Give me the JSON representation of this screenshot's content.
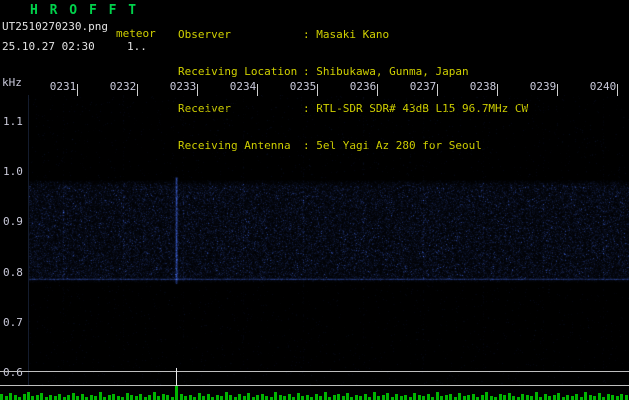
{
  "header": {
    "app_title": "H R O F F T",
    "filename": "UT2510270230.png",
    "station_label": "meteor",
    "datetime": "25.10.27 02:30",
    "counter": "1..",
    "colon": ": ",
    "info": [
      {
        "label": "Observer",
        "value": "Masaki Kano"
      },
      {
        "label": "Receiving Location",
        "value": "Shibukawa, Gunma, Japan"
      },
      {
        "label": "Receiver",
        "value": "RTL-SDR SDR# 43dB L15 96.7MHz CW"
      },
      {
        "label": "Receiving Antenna",
        "value": "5el Yagi Az 280 for Seoul"
      }
    ]
  },
  "colors": {
    "title_green": "#00d24b",
    "header_yellow": "#d0d000",
    "text_white": "#e2e2e2",
    "axis_label": "#c9c9da",
    "divider_line": "#bfbfbf",
    "bar_green": "#00b400"
  },
  "chart_data": {
    "type": "heatmap",
    "title": "HROFFT radio meteor spectrogram, 10-minute window 02:30-02:40 UT, 96.7MHz",
    "x_ticks": [
      "0231",
      "0232",
      "0233",
      "0234",
      "0235",
      "0236",
      "0237",
      "0238",
      "0239",
      "0240"
    ],
    "y_unit_label": "kHz",
    "y_ticks": [
      {
        "label": "1.1",
        "f": 1.1
      },
      {
        "label": "1.0",
        "f": 1.0
      },
      {
        "label": "0.9",
        "f": 0.9
      },
      {
        "label": "0.8",
        "f": 0.8
      },
      {
        "label": "0.7",
        "f": 0.7
      },
      {
        "label": "0.6",
        "f": 0.6
      }
    ],
    "ylim": [
      0.576,
      1.154
    ],
    "grid": false,
    "noise_band": {
      "f_top": 0.985,
      "f_bottom": 0.782
    },
    "carrier_line_freq": 0.787,
    "event": {
      "x_frac": 0.28,
      "f_top": 0.99,
      "f_bottom": 0.78
    },
    "seed": 20251027,
    "signal_bars": [
      6,
      4,
      7,
      5,
      3,
      6,
      8,
      4,
      5,
      7,
      3,
      5,
      4,
      6,
      3,
      5,
      7,
      4,
      6,
      3,
      5,
      4,
      8,
      3,
      5,
      6,
      4,
      3,
      7,
      5,
      4,
      6,
      3,
      5,
      8,
      4,
      6,
      5,
      3,
      14,
      6,
      4,
      5,
      3,
      7,
      4,
      6,
      3,
      5,
      4,
      8,
      5,
      3,
      6,
      4,
      7,
      3,
      5,
      6,
      4,
      3,
      8,
      5,
      4,
      6,
      3,
      7,
      4,
      5,
      3,
      6,
      4,
      8,
      3,
      5,
      6,
      4,
      7,
      3,
      5,
      4,
      6,
      3,
      8,
      4,
      5,
      7,
      3,
      6,
      4,
      5,
      3,
      7,
      5,
      4,
      6,
      3,
      8,
      4,
      5,
      6,
      3,
      7,
      4,
      5,
      6,
      3,
      5,
      8,
      4,
      3,
      6,
      5,
      7,
      4,
      3,
      6,
      5,
      4,
      8,
      3,
      6,
      4,
      5,
      7,
      3,
      5,
      4,
      6,
      3,
      8,
      5,
      4,
      7,
      3,
      6,
      5,
      4,
      6,
      5
    ]
  }
}
